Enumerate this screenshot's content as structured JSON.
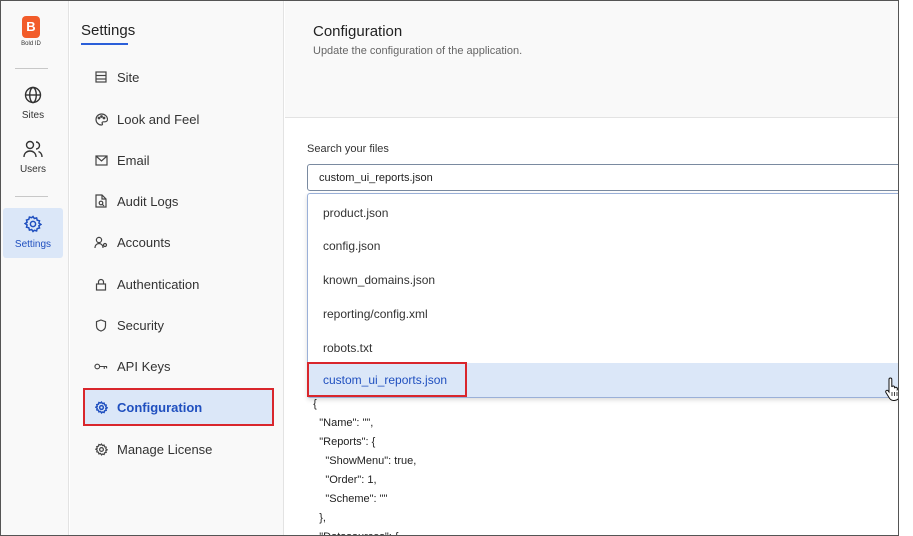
{
  "brand": {
    "logo_letter": "B",
    "caption": "Bold ID",
    "color": "#f25c2a"
  },
  "rail": {
    "items": [
      {
        "label": "Sites",
        "icon": "globe-icon"
      },
      {
        "label": "Users",
        "icon": "users-icon"
      },
      {
        "label": "Settings",
        "icon": "gear-icon",
        "active": true
      }
    ]
  },
  "sidebar": {
    "title": "Settings",
    "items": [
      {
        "label": "Site",
        "icon": "site-icon"
      },
      {
        "label": "Look and Feel",
        "icon": "palette-icon"
      },
      {
        "label": "Email",
        "icon": "mail-icon"
      },
      {
        "label": "Audit Logs",
        "icon": "audit-log-icon"
      },
      {
        "label": "Accounts",
        "icon": "accounts-icon"
      },
      {
        "label": "Authentication",
        "icon": "lock-icon"
      },
      {
        "label": "Security",
        "icon": "shield-icon"
      },
      {
        "label": "API Keys",
        "icon": "key-icon"
      },
      {
        "label": "Configuration",
        "icon": "gear-icon",
        "active": true
      },
      {
        "label": "Manage License",
        "icon": "gear-icon"
      }
    ]
  },
  "main": {
    "title": "Configuration",
    "subtitle": "Update the configuration of the application.",
    "search": {
      "label": "Search your files",
      "value": "custom_ui_reports.json"
    },
    "dropdown": {
      "options": [
        "product.json",
        "config.json",
        "known_domains.json",
        "reporting/config.xml",
        "robots.txt",
        "custom_ui_reports.json"
      ],
      "selected_index": 5
    },
    "code_lines": [
      "  {",
      "    \"Name\": \"\",",
      "    \"Reports\": {",
      "      \"ShowMenu\": true,",
      "      \"Order\": 1,",
      "      \"Scheme\": \"\"",
      "    },",
      "    \"Datasources\": {"
    ]
  },
  "colors": {
    "accent": "#1f4fbf",
    "selected_bg": "#dbe7f8",
    "highlight_box": "#d9262c"
  }
}
